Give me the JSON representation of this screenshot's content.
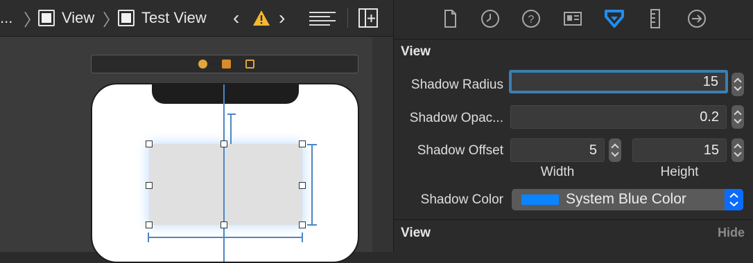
{
  "jumpbar": {
    "ellipsis": "...",
    "crumbs": [
      "View",
      "Test View"
    ],
    "warning_icon": "warning-triangle-icon"
  },
  "inspector": {
    "tabs": [
      "file-icon",
      "history-icon",
      "help-icon",
      "identity-icon",
      "attributes-icon",
      "size-ruler-icon",
      "connections-icon"
    ],
    "section_title": "View",
    "shadow_radius_label": "Shadow Radius",
    "shadow_radius_value": "15",
    "shadow_opacity_label": "Shadow Opac...",
    "shadow_opacity_value": "0.2",
    "shadow_offset_label": "Shadow Offset",
    "shadow_offset_width": "5",
    "shadow_offset_height": "15",
    "width_label": "Width",
    "height_label": "Height",
    "shadow_color_label": "Shadow Color",
    "shadow_color_value": "System Blue Color",
    "shadow_color_hex": "#0a84ff",
    "second_section_title": "View",
    "hide_label": "Hide"
  },
  "colors": {
    "accent": "#0a84ff",
    "selected_tab": "#1f8ef1",
    "focus_ring": "#3a7fb3"
  }
}
